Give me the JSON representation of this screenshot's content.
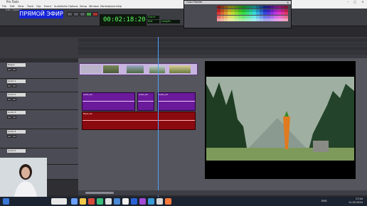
{
  "window": {
    "title": "Pro Tools"
  },
  "menu": [
    "File",
    "Edit",
    "View",
    "Track",
    "Clip",
    "Event",
    "AudioSuite",
    "Options",
    "Setup",
    "Window",
    "Marketplace",
    "Help"
  ],
  "overlay": {
    "live_banner": "ПРЯМОЙ ЭФИР"
  },
  "edit_window": {
    "title": "Edit: Проект"
  },
  "transport": {
    "main_counter": "00:02:18:20",
    "start_label": "Start",
    "end_label": "End",
    "length_label": "Length"
  },
  "color_palette": {
    "title": "Color Palette"
  },
  "tracks": [
    {
      "name": "Видео"
    },
    {
      "name": "Audio 1"
    },
    {
      "name": "Audio 2"
    },
    {
      "name": "Audio 3"
    },
    {
      "name": "Audio 4"
    },
    {
      "name": "Audio 5"
    },
    {
      "name": "Audio 6"
    }
  ],
  "clips": {
    "video_label": "video_01",
    "audio_a": "Audio_01",
    "audio_b": "Audio_02",
    "audio_c": "Audio_03",
    "music": "Music_01"
  },
  "taskbar": {
    "time": "17:44",
    "date": "11.05.2024",
    "lang": "ENG"
  },
  "colors": {
    "live_banner": "#1424d6",
    "audio_clip": "#6a1a9a",
    "music_clip": "#8a0a10",
    "counter_text": "#60ff60",
    "cursor": "#4aa3ff"
  },
  "icons": [
    "minimize-icon",
    "maximize-icon",
    "close-icon",
    "play-icon",
    "stop-icon",
    "record-icon",
    "rewind-icon",
    "forward-icon"
  ]
}
